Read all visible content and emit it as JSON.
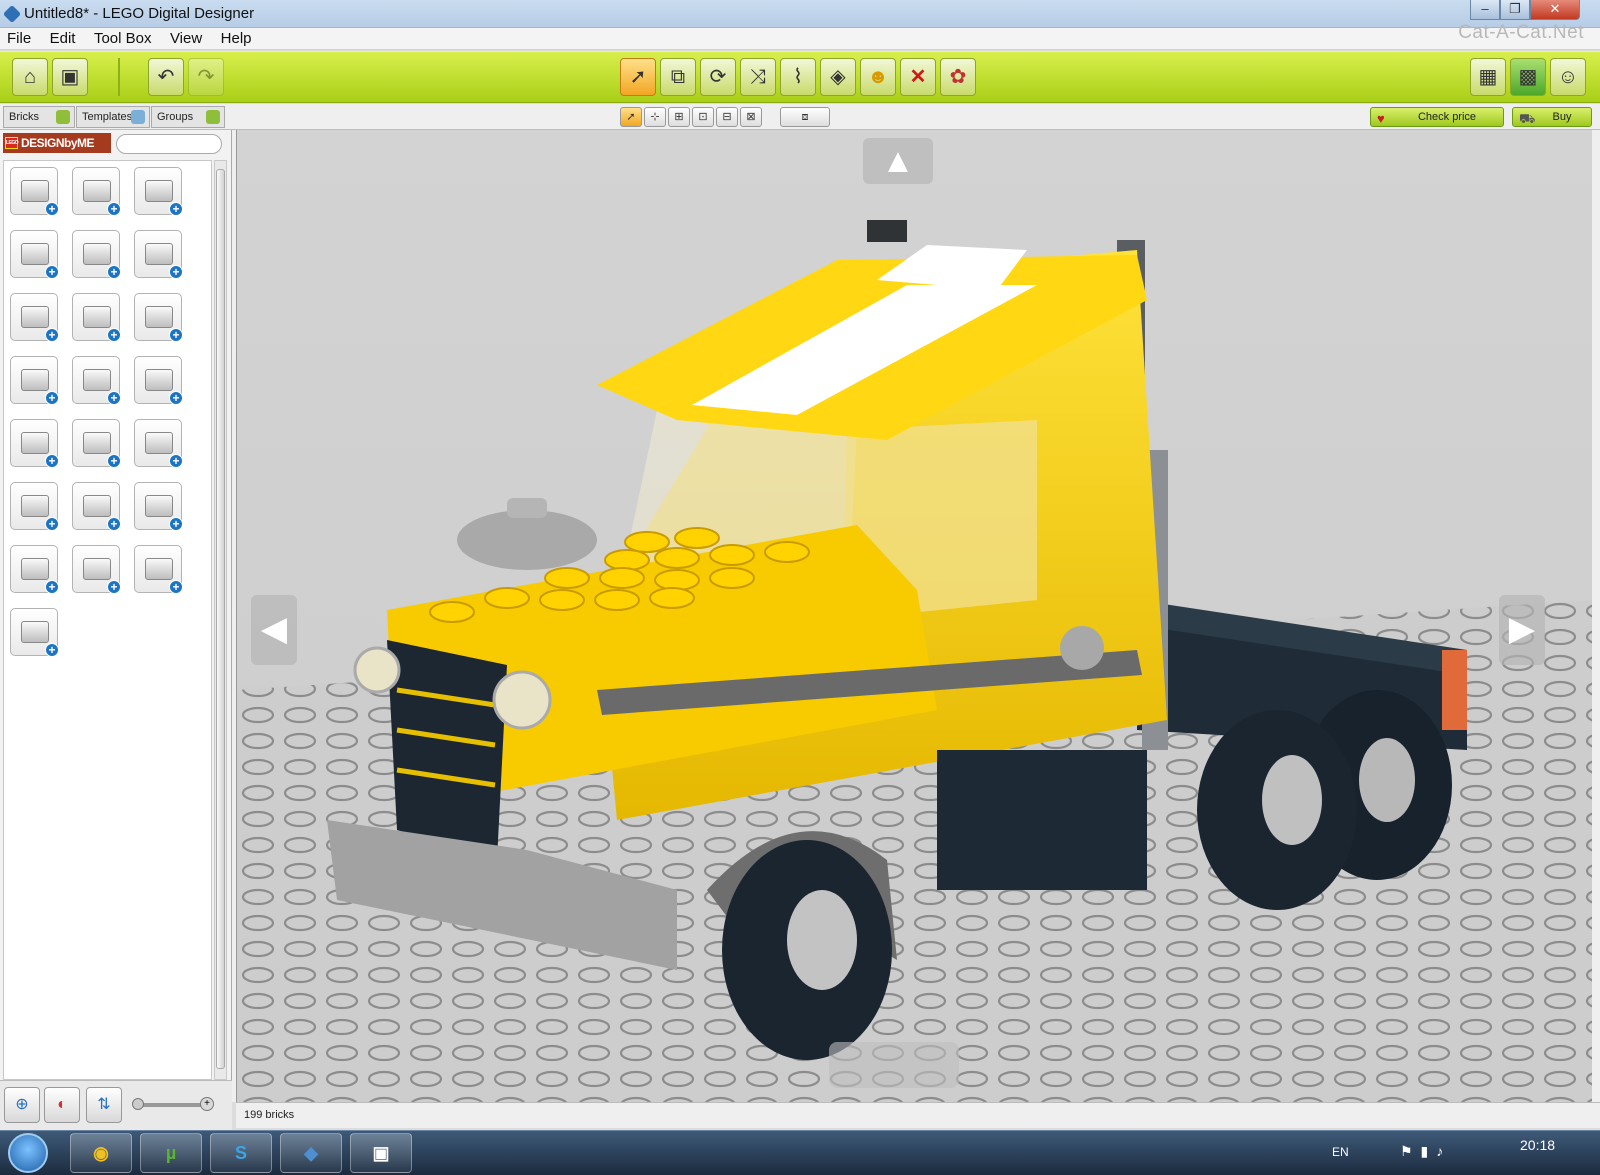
{
  "window": {
    "title": "Untitled8* - LEGO Digital Designer",
    "minimize": "‒",
    "maximize": "❐",
    "close": "✕"
  },
  "watermark": "Cat-A-Cat.Net",
  "menu": [
    "File",
    "Edit",
    "Tool Box",
    "View",
    "Help"
  ],
  "toolbar": {
    "left": [
      "home-icon",
      "save-icon",
      "undo-icon",
      "redo-icon"
    ],
    "tools": [
      "select-tool",
      "clone-tool",
      "hinge-tool",
      "hinge-align-tool",
      "flex-tool",
      "paint-tool",
      "hide-tool",
      "delete-tool",
      "color-tool"
    ],
    "modes": [
      "build-mode-icon",
      "view-mode-icon",
      "building-guide-icon"
    ]
  },
  "subbar": {
    "tabs": [
      {
        "label": "Bricks"
      },
      {
        "label": "Templates"
      },
      {
        "label": "Groups"
      }
    ],
    "check_price": "Check price",
    "buy": "Buy"
  },
  "panel": {
    "logo": "DESIGNbyME",
    "logo_mark": "LEGO",
    "search_value": "",
    "bricks": [
      "brick-2x2",
      "brick-corner",
      "brick-round",
      "brick-2x4",
      "slope-brick",
      "slope-curved",
      "arch-brick",
      "plate-2x2",
      "plate-2x3",
      "technic-brick",
      "tile-brick",
      "plate-bracket",
      "door-brick",
      "wheel-brick",
      "antenna-brick",
      "minifig-brick",
      "headlight-brick",
      "technic-beam",
      "axle-brick",
      "gear-brick",
      "pipe-brick",
      "baseplate-brick"
    ]
  },
  "status": {
    "bricks": "199 bricks"
  },
  "taskbar": {
    "lang": "EN",
    "time": "20:18",
    "apps": [
      "chrome-icon",
      "utorrent-icon",
      "skype-icon",
      "lego-icon",
      "app-icon"
    ]
  },
  "colors": {
    "toolbar": "#b5d62a",
    "truck_yellow": "#f5cd0a",
    "truck_dark": "#1d2a35",
    "stripe": "#ffffff"
  }
}
